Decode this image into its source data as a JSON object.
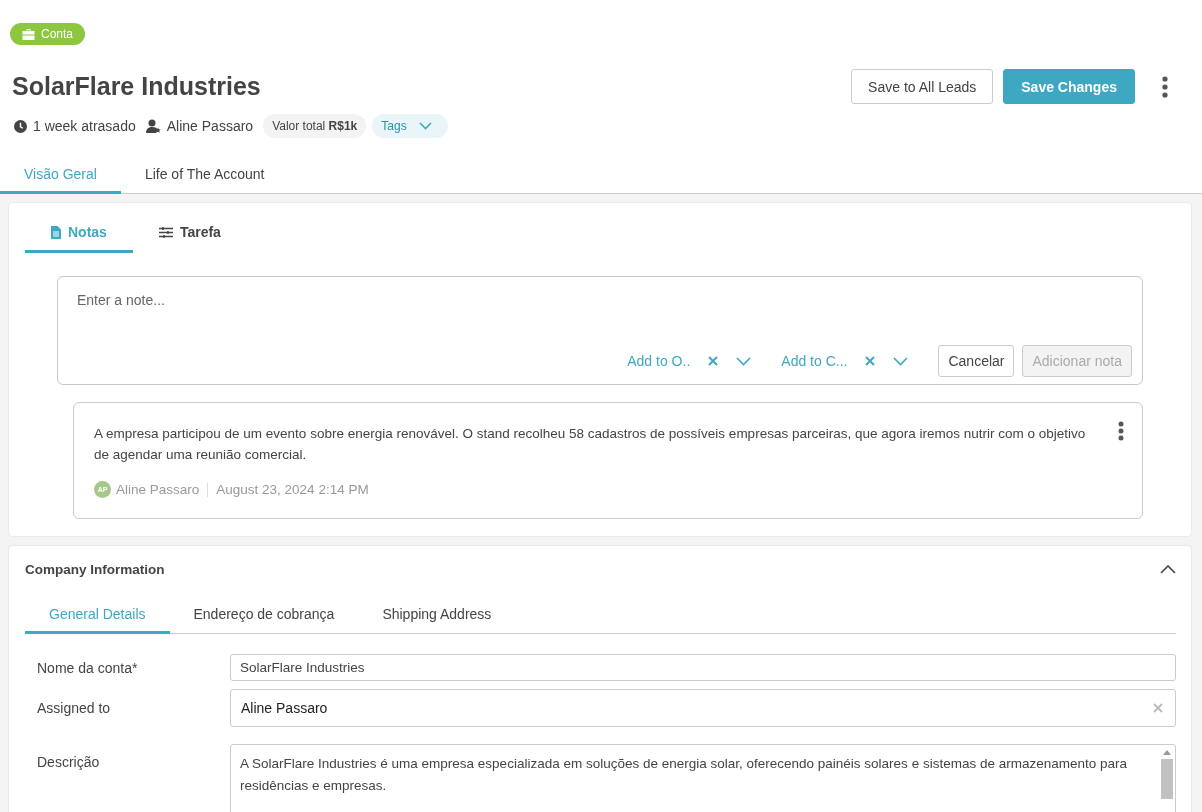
{
  "badge": {
    "label": "Conta"
  },
  "title": "SolarFlare Industries",
  "meta": {
    "due": "1 week atrasado",
    "owner": "Aline Passaro",
    "total": "Valor total **R$1k**",
    "tags": "Tags"
  },
  "actions": [
    {
      "label": "Save to All Leads",
      "kind": "secondary"
    },
    {
      "label": "Save Changes",
      "kind": "primary"
    }
  ],
  "main_tabs": [
    {
      "label": "Visão Geral",
      "selected": true
    },
    {
      "label": "Life of The Account",
      "selected": false
    }
  ],
  "note_tabs": [
    {
      "label": "Notas",
      "kind": "notes",
      "selected": true
    },
    {
      "label": "Tarefa",
      "kind": "task",
      "selected": false
    }
  ],
  "editor": {
    "placeholder": "Enter a note...",
    "selectors": [
      {
        "label": "Add to O.."
      },
      {
        "label": "Add to C..."
      }
    ],
    "cancel": "Cancelar",
    "submit": {
      "label": "Adicionar nota",
      "disabled": true
    }
  },
  "notes": [
    {
      "text": "A empresa participou de um evento sobre energia renovável.  O stand recolheu 58 cadastros de possíveis empresas parceiras, que agora iremos nutrir com o objetivo de agendar uma reunião comercial.",
      "initials": "AP",
      "author": "Aline Passaro",
      "date": "August 23, 2024 2:14 PM"
    }
  ],
  "company": {
    "title": "Company Information",
    "expanded": true,
    "tabs": [
      {
        "label": "General Details",
        "selected": true
      },
      {
        "label": "Endereço de cobrança",
        "selected": false
      },
      {
        "label": "Shipping Address",
        "selected": false
      }
    ],
    "fields": [
      {
        "label": "Nome da conta*",
        "value": "SolarFlare Industries",
        "kind": "text"
      },
      {
        "label": "Assigned to",
        "value": "Aline Passaro",
        "kind": "select"
      },
      {
        "label": "Descrição",
        "value": "A SolarFlare Industries é uma empresa especializada em soluções de energia solar, oferecendo painéis solares e sistemas de armazenamento para residências e empresas.",
        "kind": "textarea"
      }
    ]
  }
}
